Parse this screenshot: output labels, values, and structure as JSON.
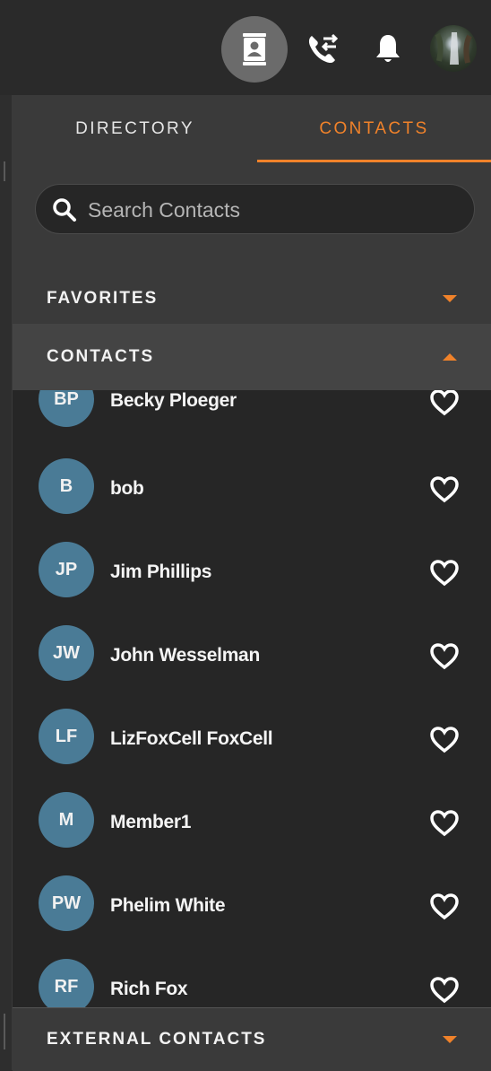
{
  "tabs": {
    "directory": "DIRECTORY",
    "contacts": "CONTACTS"
  },
  "search": {
    "placeholder": "Search Contacts",
    "value": ""
  },
  "sections": {
    "favorites": "FAVORITES",
    "contacts": "CONTACTS",
    "external": "EXTERNAL CONTACTS"
  },
  "contacts": [
    {
      "initials": "BP",
      "name": "Becky Ploeger"
    },
    {
      "initials": "B",
      "name": "bob"
    },
    {
      "initials": "JP",
      "name": "Jim Phillips"
    },
    {
      "initials": "JW",
      "name": "John Wesselman"
    },
    {
      "initials": "LF",
      "name": "LizFoxCell FoxCell"
    },
    {
      "initials": "M",
      "name": "Member1"
    },
    {
      "initials": "PW",
      "name": "Phelim White"
    },
    {
      "initials": "RF",
      "name": "Rich Fox"
    }
  ],
  "colors": {
    "accent": "#f0822a",
    "avatar": "#4a7b96",
    "panel": "#3a3a3a",
    "background": "#262626"
  },
  "icons": {
    "top": [
      "contact-book-icon",
      "call-transfer-icon",
      "bell-icon",
      "user-avatar"
    ],
    "row": "heart-outline-icon",
    "search": "search-icon"
  }
}
